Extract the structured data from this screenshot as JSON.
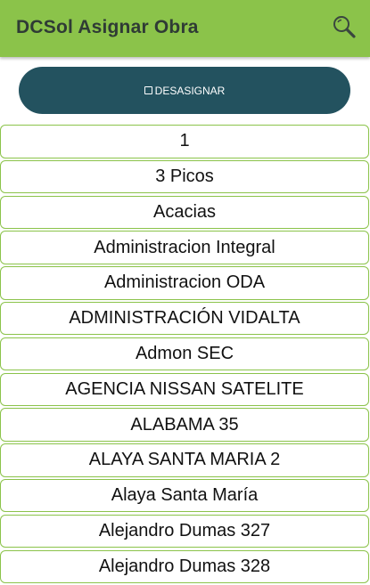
{
  "appbar": {
    "title": "DCSol Asignar Obra",
    "search_icon": "search-icon",
    "color": "#8bc34a"
  },
  "action": {
    "desasignar_label": "DESASIGNAR",
    "color": "#23525f"
  },
  "list": {
    "items": [
      "1",
      "3 Picos",
      "Acacias",
      "Administracion Integral",
      "Administracion ODA",
      "ADMINISTRACIÓN VIDALTA",
      "Admon SEC",
      "AGENCIA NISSAN SATELITE",
      "ALABAMA 35",
      "ALAYA SANTA MARIA 2",
      "Alaya Santa María",
      "Alejandro Dumas 327",
      "Alejandro Dumas 328"
    ]
  }
}
